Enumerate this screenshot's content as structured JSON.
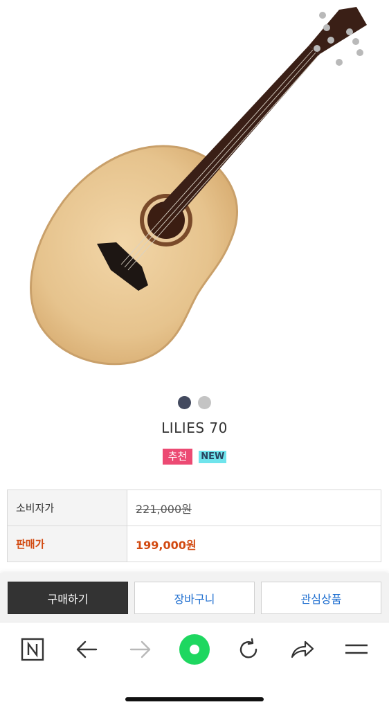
{
  "product": {
    "title": "LILIES 70",
    "badges": {
      "recommend": "추천",
      "new": "NEW"
    },
    "carousel": {
      "count": 2,
      "active_index": 0
    }
  },
  "price_table": {
    "consumer_label": "소비자가",
    "consumer_price": "221,000원",
    "sale_label": "판매가",
    "sale_price": "199,000원"
  },
  "actions": {
    "buy": "구매하기",
    "cart": "장바구니",
    "wishlist": "관심상품"
  },
  "browser_toolbar": {
    "icons": [
      "naver-n-icon",
      "back-arrow-icon",
      "forward-arrow-icon",
      "green-dot-icon",
      "reload-icon",
      "share-icon",
      "menu-icon"
    ]
  },
  "colors": {
    "sale": "#d24a11",
    "button_text": "#1f6fd0",
    "badge_recommend": "#ec4a73",
    "badge_new": "#6fe4ec",
    "dot_active": "#434a5f",
    "green": "#1ed760"
  }
}
